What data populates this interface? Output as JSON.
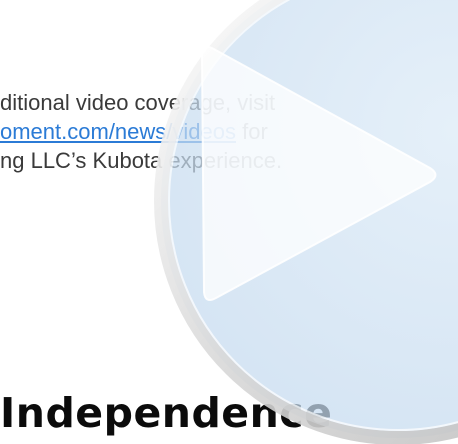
{
  "article": {
    "line1": "ditional video coverage, visit",
    "link_text": "oment.com/news/videos",
    "line2_suffix": " for",
    "line3": "ng LLC’s Kubota experience.",
    "headline": "Independence"
  },
  "video": {
    "play_icon": "play-icon"
  },
  "colors": {
    "link": "#2b7bd6",
    "body_text": "#3a3a3a",
    "headline": "#0b0b0b",
    "overlay_fill": "#cfe3f4"
  }
}
